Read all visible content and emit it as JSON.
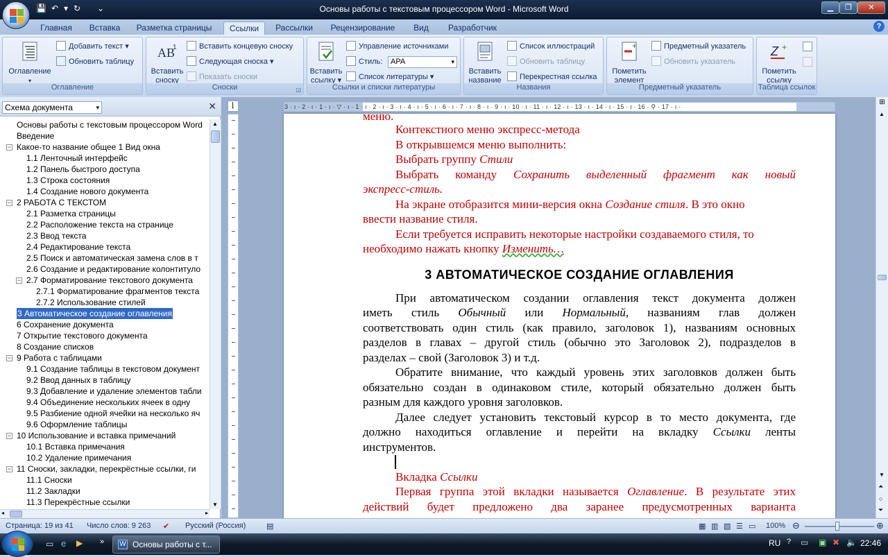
{
  "window": {
    "title": "Основы работы с текстовым процессором Word - Microsoft Word"
  },
  "tabs": [
    "Главная",
    "Вставка",
    "Разметка страницы",
    "Ссылки",
    "Рассылки",
    "Рецензирование",
    "Вид",
    "Разработчик"
  ],
  "active_tab": "Ссылки",
  "ribbon": {
    "toc": {
      "big": "Оглавление",
      "add_text": "Добавить текст",
      "update_table": "Обновить таблицу",
      "label": "Оглавление"
    },
    "footnotes": {
      "big1": "Вставить",
      "big2": "сноску",
      "insert_endnote": "Вставить концевую сноску",
      "next_footnote": "Следующая сноска",
      "show_notes": "Показать сноски",
      "label": "Сноски"
    },
    "citations": {
      "big1": "Вставить",
      "big2": "ссылку",
      "manage": "Управление источниками",
      "style_label": "Стиль:",
      "style_value": "APA",
      "bibliography": "Список литературы",
      "label": "Ссылки и списки литературы"
    },
    "captions": {
      "big1": "Вставить",
      "big2": "название",
      "table_of_figures": "Список иллюстраций",
      "update_table": "Обновить таблицу",
      "cross_ref": "Перекрестная ссылка",
      "label": "Названия"
    },
    "index": {
      "big1": "Пометить",
      "big2": "элемент",
      "insert_index": "Предметный указатель",
      "update_index": "Обновить указатель",
      "label": "Предметный указатель"
    },
    "toa": {
      "big1": "Пометить",
      "big2": "ссылку",
      "label": "Таблица ссылок"
    }
  },
  "docmap": {
    "header": "Схема документа",
    "items": [
      {
        "text": "Основы работы с текстовым процессором Word",
        "level": 0,
        "toggle": ""
      },
      {
        "text": "Введение",
        "level": 0,
        "toggle": ""
      },
      {
        "text": "Какое-то название общее 1 Вид окна",
        "level": 0,
        "toggle": "−"
      },
      {
        "text": "1.1 Ленточный интерфейс",
        "level": 1,
        "toggle": ""
      },
      {
        "text": "1.2 Панель быстрого доступа",
        "level": 1,
        "toggle": ""
      },
      {
        "text": "1.3 Строка состояния",
        "level": 1,
        "toggle": ""
      },
      {
        "text": "1.4 Создание нового документа",
        "level": 1,
        "toggle": ""
      },
      {
        "text": "2 РАБОТА С ТЕКСТОМ",
        "level": 0,
        "toggle": "−"
      },
      {
        "text": "2.1 Разметка страницы",
        "level": 1,
        "toggle": ""
      },
      {
        "text": "2.2 Расположение текста на странице",
        "level": 1,
        "toggle": ""
      },
      {
        "text": "2.3 Ввод текста",
        "level": 1,
        "toggle": ""
      },
      {
        "text": "2.4 Редактирование текста",
        "level": 1,
        "toggle": ""
      },
      {
        "text": "2.5 Поиск и автоматическая замена слов в т",
        "level": 1,
        "toggle": ""
      },
      {
        "text": "2.6 Создание и редактирование колонтитуло",
        "level": 1,
        "toggle": ""
      },
      {
        "text": "2.7 Форматирование текстового документа",
        "level": 1,
        "toggle": "−"
      },
      {
        "text": "2.7.1 Форматирование  фрагментов текста",
        "level": 2,
        "toggle": ""
      },
      {
        "text": "2.7.2 Использование стилей",
        "level": 2,
        "toggle": ""
      },
      {
        "text": "3 Автоматическое создание оглавления",
        "level": 0,
        "toggle": "",
        "selected": true
      },
      {
        "text": "6 Сохранение документа",
        "level": 0,
        "toggle": ""
      },
      {
        "text": "7 Открытие текстового документа",
        "level": 0,
        "toggle": ""
      },
      {
        "text": "8 Создание списков",
        "level": 0,
        "toggle": ""
      },
      {
        "text": "9 Работа с таблицами",
        "level": 0,
        "toggle": "−"
      },
      {
        "text": "9.1 Создание таблицы в текстовом документ",
        "level": 1,
        "toggle": ""
      },
      {
        "text": "9.2 Ввод данных в таблицу",
        "level": 1,
        "toggle": ""
      },
      {
        "text": "9.3 Добавление и удаление элементов табли",
        "level": 1,
        "toggle": ""
      },
      {
        "text": "9.4 Объединение нескольких ячеек в одну",
        "level": 1,
        "toggle": ""
      },
      {
        "text": "9.5 Разбиение одной ячейки на несколько яч",
        "level": 1,
        "toggle": ""
      },
      {
        "text": "9.6 Оформление таблицы",
        "level": 1,
        "toggle": ""
      },
      {
        "text": "10 Использование и вставка  примечаний",
        "level": 0,
        "toggle": "−"
      },
      {
        "text": "10.1 Вставка примечания",
        "level": 1,
        "toggle": ""
      },
      {
        "text": "10.2 Удаление примечания",
        "level": 1,
        "toggle": ""
      },
      {
        "text": "11 Сноски, закладки, перекрёстные ссылки, ги",
        "level": 0,
        "toggle": "−"
      },
      {
        "text": "11.1 Сноски",
        "level": 1,
        "toggle": ""
      },
      {
        "text": "11.2 Закладки",
        "level": 1,
        "toggle": ""
      },
      {
        "text": "11.3 Перекрёстные ссылки",
        "level": 1,
        "toggle": ""
      }
    ]
  },
  "document": {
    "top_cut": "меню.",
    "l1": "Контекстного меню экспресс-метода",
    "l2": "В открывшемся меню выполнить:",
    "l3a": "Выбрать  группу ",
    "l3b": "Стили",
    "l4a": "Выбрать команду ",
    "l4b": "Сохранить выделенный фрагмент как новый",
    "l5": "экспресс-стиль.",
    "l6a": "На экране отобразится мини-версия окна ",
    "l6b": "Создание стиля",
    ". В это окно": "",
    "l6c": ". В это окно",
    "l7": "ввести название стиля.",
    "l8": "Если требуется исправить некоторые настройки создаваемого стиля, то",
    "l9a": "необходимо нажать кнопку ",
    "l9b": "Изменить…",
    "heading": "3 АВТОМАТИЧЕСКОЕ СОЗДАНИЕ ОГЛАВЛЕНИЯ",
    "p1": "При автоматическом создании оглавления текст документа должен",
    "p2a": "иметь стиль  ",
    "p2b": "Обычный",
    "p2c": " или ",
    "p2d": "Нормальный",
    "p2e": ", названиям глав должен",
    "p3": "соответствовать один стиль (как правило, заголовок 1), названиям основных",
    "p4": "разделов в главах – другой стиль (обычно это Заголовок 2), подразделов в",
    "p5": "разделах – свой (Заголовок 3) и т.д.",
    "p6": "Обратите внимание, что каждый уровень этих заголовков должен быть",
    "p7": "обязательно создан в одинаковом стиле, который обязательно должен быть",
    "p8": "разным для каждого уровня заголовков.",
    "p9": "Далее следует установить текстовый курсор в то место документа, где",
    "p10a": "должно находиться оглавление и перейти на вкладку ",
    "p10b": "Ссылки",
    "p10c": " ленты",
    "p11": "инструментов.",
    "r1a": "Вкладка ",
    "r1b": "Ссылки",
    "r2a": "Первая группа этой вкладки называется ",
    "r2b": "Оглавление",
    "r2c": ". В результате этих",
    "r3": "действий будет предложено два заранее предусмотренных варианта"
  },
  "ruler": {
    "marks": "3 · ı · 2 · ı · 1 · ı · ▽ · ı · 1 · ı · 2 · ı · 3 · ı · 4 · ı · 5 · ı · 6 · ı · 7 · ı · 8 · ı · 9 · ı · 10 · ı · 11 · ı · 12 · ı · 13 · ı · 14 · ı · 15 · ı · 16 · ⚲ · 17 · ı ·"
  },
  "status": {
    "page": "Страница: 19 из 41",
    "words": "Число слов: 9 263",
    "lang": "Русский (Россия)",
    "zoom": "100%"
  },
  "taskbar": {
    "button": "Основы работы с т...",
    "lang": "RU",
    "clock": "22:46"
  },
  "colors": {
    "red_text": "#c00000",
    "selection": "#316ac5",
    "ribbon_bg": "#d3e0f1"
  }
}
